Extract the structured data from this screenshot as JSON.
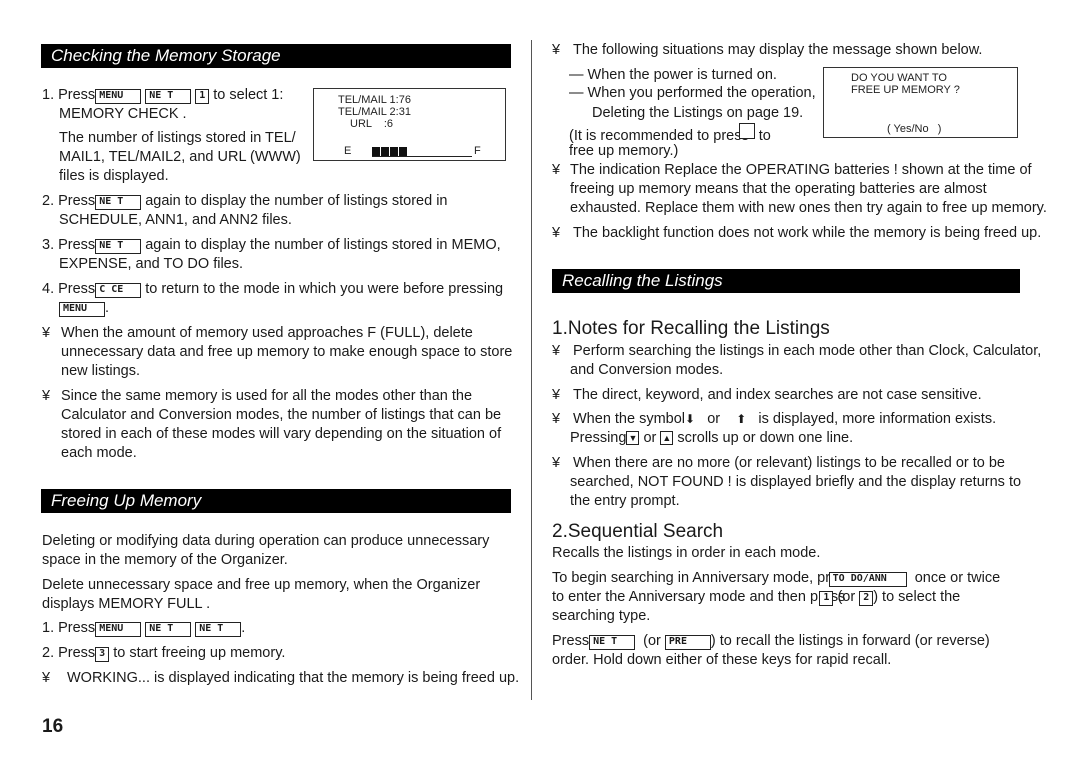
{
  "left": {
    "section1": {
      "title": "Checking the Memory Storage",
      "step1": {
        "prefix": "1. Press",
        "keys": [
          "MENU",
          "NE T",
          "1"
        ],
        "suffix": "to select  1:",
        "line2": "MEMORY CHECK .",
        "para_l1": "The number of listings stored in TEL/",
        "para_l2": "MAIL1, TEL/MAIL2, and URL (WWW)",
        "para_l3": "files is displayed."
      },
      "lcd": {
        "line1": "TEL/MAIL 1:76",
        "line2": "TEL/MAIL 2:31",
        "line3": "URL    :6",
        "empty_label": "E",
        "full_label": "F",
        "fill_segments": 4,
        "total_segments": 10
      },
      "step2": {
        "prefix": "2. Press",
        "key": "NE T",
        "suffix": "again to display the number of listings stored in",
        "line2": "SCHEDULE, ANN1, and ANN2 files."
      },
      "step3": {
        "prefix": "3. Press",
        "key": "NE T",
        "suffix": "again to display the number of listings stored in MEMO,",
        "line2": "EXPENSE, and TO DO files."
      },
      "step4": {
        "prefix": "4. Press",
        "key": "C CE",
        "suffix": "to return to the mode in which you were before pressing",
        "key2": "MENU",
        "end": "."
      },
      "note1": {
        "bullet": "¥",
        "l1": "When the amount of memory used approaches F (FULL), delete",
        "l2": "unnecessary data and free up memory to make enough space to store",
        "l3": "new listings."
      },
      "note2": {
        "bullet": "¥",
        "l1": "Since the same memory is used for all the modes other than the",
        "l2": "Calculator and Conversion modes, the number of listings that can be",
        "l3": "stored in each of these modes will vary depending on the situation of",
        "l4": "each mode."
      }
    },
    "section2": {
      "title": "Freeing Up Memory",
      "p1_l1": "Deleting or modifying data during operation can produce unnecessary",
      "p1_l2": "space in the memory of the Organizer.",
      "p2_l1": "Delete unnecessary space and free up memory, when the Organizer",
      "p2_l2": "displays  MEMORY FULL .",
      "step1": {
        "prefix": "1. Press",
        "keys": [
          "MENU",
          "NE T",
          "NE T"
        ],
        "end": "."
      },
      "step2": {
        "prefix": "2. Press",
        "key": "3",
        "suffix": "to start freeing up memory."
      },
      "note": {
        "bullet": "¥",
        "text": "WORKING...  is displayed indicating that the memory is being freed up."
      }
    }
  },
  "right": {
    "intro": {
      "bullet": "¥",
      "text": "The following situations may display the message shown below."
    },
    "dash1": "—  When the power is turned on.",
    "dash2": "—  When you performed the operation,",
    "dash2b": "Deleting the Listings  on page 19.",
    "rec_l1a": "(It is recommended to press",
    "rec_l1b": "to",
    "rec_l2": "free up memory.)",
    "lcd": {
      "line1": "DO YOU WANT TO",
      "line2": "FREE UP MEMORY ?",
      "line3": "( Yes/No   )"
    },
    "note_batt": {
      "bullet": "¥",
      "l1": "The indication  Replace the OPERATING batteries !  shown at the time of",
      "l2": "freeing up memory means that the operating batteries are almost",
      "l3": "exhausted. Replace them with new ones then try again to free up memory."
    },
    "note_back": {
      "bullet": "¥",
      "text": "The backlight function does not work while the memory is being freed up."
    },
    "section3": {
      "title": "Recalling the Listings",
      "sub1": "1.Notes for Recalling the Listings",
      "n1": {
        "bullet": "¥",
        "l1": "Perform searching the listings in each mode other than Clock, Calculator,",
        "l2": "and Conversion modes."
      },
      "n2": {
        "bullet": "¥",
        "text": "The direct, keyword, and index searches are not case sensitive."
      },
      "n3": {
        "bullet": "¥",
        "l1a": "When the symbol",
        "down": "⬇",
        "or": "or",
        "up": "⬆",
        "l1b": "is displayed, more information exists.",
        "l2a": "Pressing",
        "key_down": "▼",
        "l2or": "or",
        "key_up": "▲",
        "l2b": "scrolls up or down one line."
      },
      "n4": {
        "bullet": "¥",
        "l1": "When there are no more (or relevant) listings to be recalled or to be",
        "l2": "searched,  NOT FOUND !  is displayed briefly and the display returns to",
        "l3": "the entry prompt."
      },
      "sub2": "2.Sequential Search",
      "s2_intro": "Recalls the listings in order in each mode.",
      "s2_p1_a": "To begin searching in Anniversary mode, press",
      "s2_key1": "TO DO/ANN",
      "s2_p1_b": "once or twice",
      "s2_p2_a": "to enter the Anniversary mode and then press",
      "s2_key2": "1",
      "s2_p2_or": "(or",
      "s2_key3": "2",
      "s2_p2_b": ") to select the",
      "s2_p3": "searching type.",
      "s2_p4_a": "Press",
      "s2_key4": "NE T",
      "s2_p4_or": "(or",
      "s2_key5": "PRE",
      "s2_p4_b": ") to recall the listings in forward (or reverse)",
      "s2_p5": "order. Hold down either of these keys for rapid recall."
    }
  },
  "page_number": "16"
}
